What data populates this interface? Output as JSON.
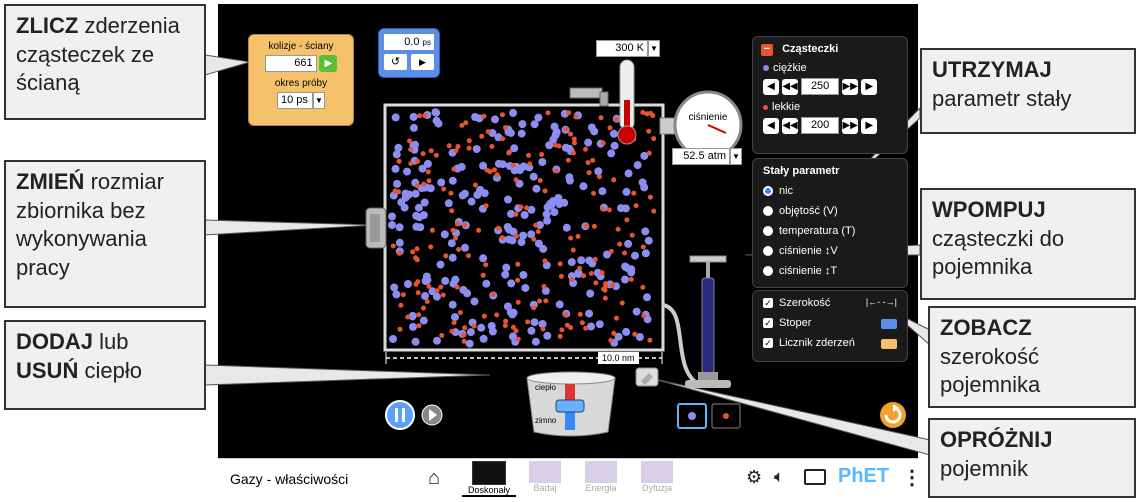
{
  "callouts": {
    "count": {
      "bold": "ZLICZ",
      "text": " zderzenia cząsteczek ze ścianą"
    },
    "hold": {
      "bold": "UTRZYMAJ",
      "text": "parametr stały"
    },
    "resize": {
      "bold": "ZMIEŃ",
      "text": " rozmiar zbiornika bez wykonywania pracy"
    },
    "pump": {
      "bold": "WPOMPUJ",
      "text": "cząsteczki do pojemnika"
    },
    "heat": {
      "bold1": "DODAJ",
      "mid": " lub ",
      "bold2": "USUŃ",
      "text": " ciepło"
    },
    "see": {
      "bold": "ZOBACZ",
      "text": "szerokość pojemnika"
    },
    "empty": {
      "bold": "OPRÓŻNIJ",
      "text": "pojemnik"
    }
  },
  "collision_counter": {
    "title": "kolizje - ściany",
    "value": "661",
    "period_label": "okres próby",
    "period_value": "10 ps"
  },
  "stopwatch": {
    "value": "0.0",
    "unit": "ps"
  },
  "thermometer": {
    "value": "300 K"
  },
  "pressure": {
    "label": "ciśnienie",
    "value": "52.5 atm"
  },
  "particles_panel": {
    "title": "Cząsteczki",
    "heavy_label": "ciężkie",
    "heavy_value": "250",
    "light_label": "lekkie",
    "light_value": "200"
  },
  "constant_panel": {
    "title": "Stały parametr",
    "options": [
      "nic",
      "objętość (V)",
      "temperatura (T)",
      "ciśnienie ↕V",
      "ciśnienie ↕T"
    ],
    "selected": 0
  },
  "tools_panel": {
    "width": "Szerokość",
    "stopwatch": "Stoper",
    "collision": "Licznik zderzeń"
  },
  "container": {
    "width_label": "10.0 nm"
  },
  "heater": {
    "hot": "ciepło",
    "cold": "zimno"
  },
  "nav": {
    "title": "Gazy - właściwości",
    "screens": [
      "Doskonały",
      "Badaj",
      "Energia",
      "Dyfuzja"
    ],
    "brand": "PhET"
  },
  "colors": {
    "heavy": "#8b8ef0",
    "light": "#e8542f",
    "accent": "#3a86ff",
    "counter_bg": "#f5c26b"
  }
}
